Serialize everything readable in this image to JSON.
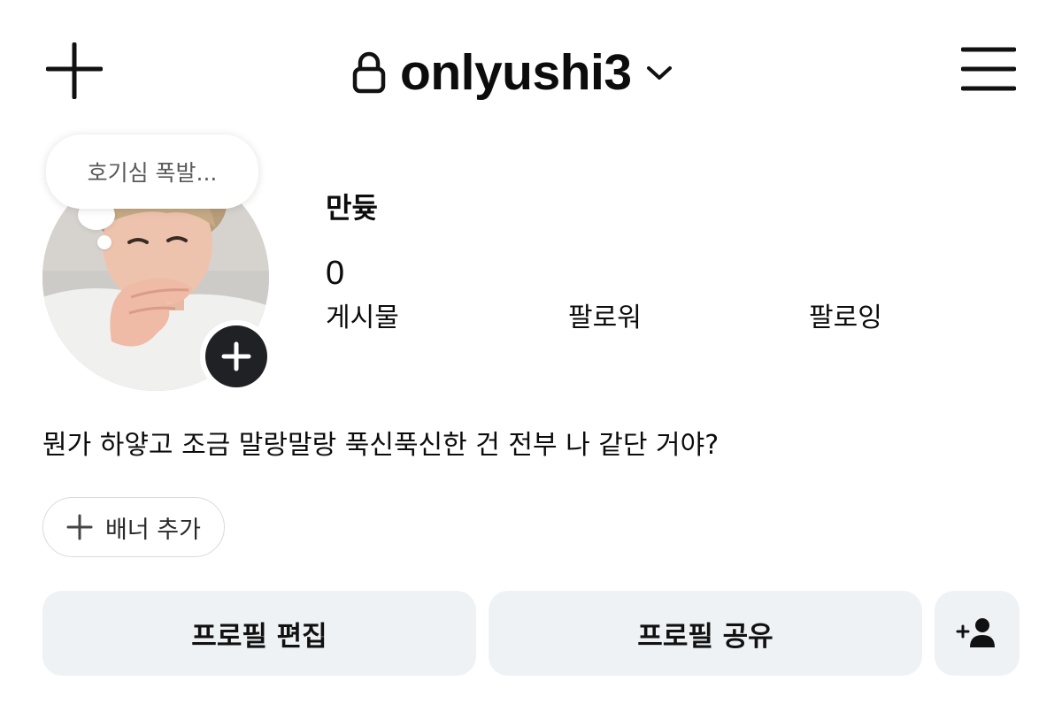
{
  "header": {
    "username": "onlyushi3",
    "icons": {
      "new": "plus-icon",
      "lock": "lock-icon",
      "switch": "chevron-down-icon",
      "menu": "hamburger-menu-icon"
    }
  },
  "profile": {
    "note": "호기심 폭발...",
    "display_name": "만듖",
    "stats": {
      "posts_count": "0",
      "posts_label": "게시물",
      "followers_label": "팔로워",
      "following_label": "팔로잉"
    },
    "bio": "뭔가 하얗고 조금 말랑말랑 푹신푹신한 건 전부 나 같단 거야?"
  },
  "banner": {
    "label": "배너 추가"
  },
  "actions": {
    "edit_label": "프로필 편집",
    "share_label": "프로필 공유",
    "discover_icon": "add-person-icon"
  },
  "colors": {
    "background": "#ffffff",
    "button_bg": "#eff2f5",
    "text": "#0c0c0c",
    "muted_text": "#5a5a5a",
    "dark_badge": "#1f2124"
  }
}
